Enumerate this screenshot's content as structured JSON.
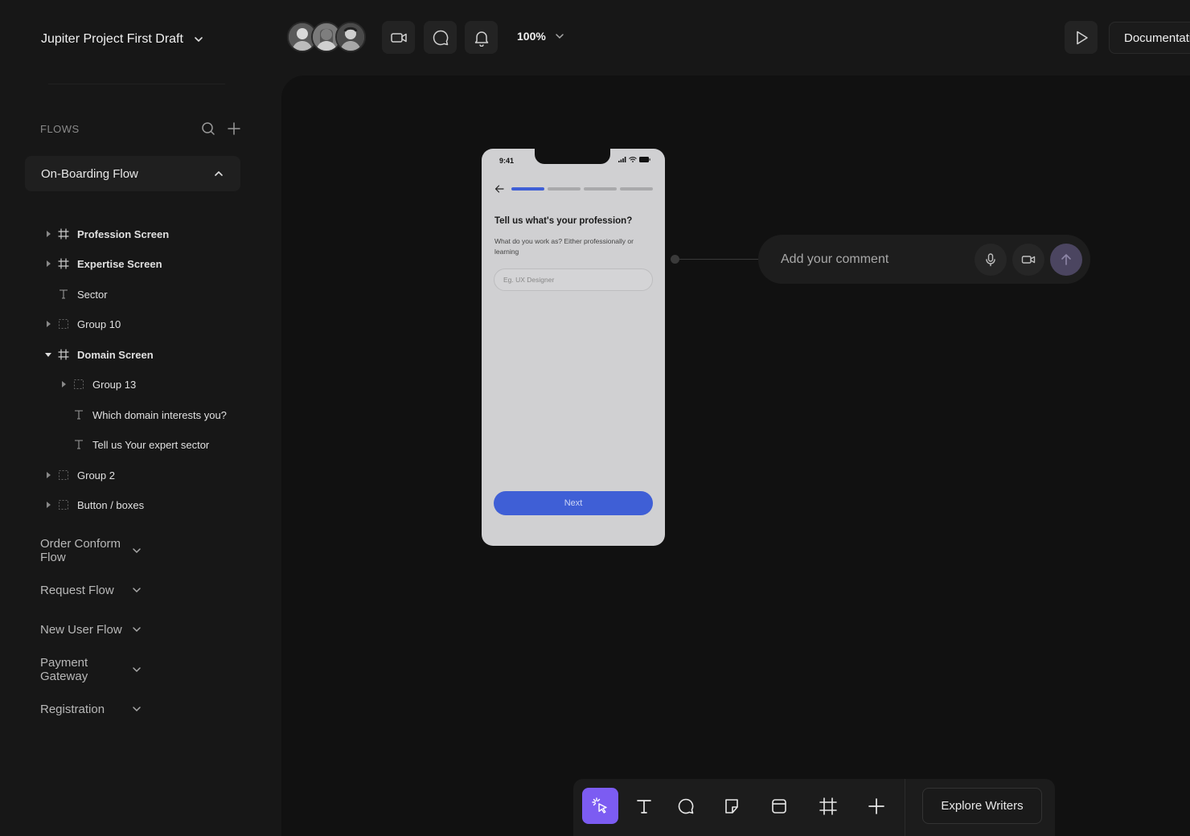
{
  "project": {
    "title": "Jupiter Project First Draft"
  },
  "sidebar": {
    "flows_label": "FLOWS",
    "active_flow": "On-Boarding Flow",
    "layers": [
      {
        "label": "Profession Screen",
        "type": "frame",
        "expandable": true,
        "expanded": false,
        "indent": 0,
        "bold": true
      },
      {
        "label": "Expertise Screen",
        "type": "frame",
        "expandable": true,
        "expanded": false,
        "indent": 0,
        "bold": true
      },
      {
        "label": "Sector",
        "type": "text",
        "expandable": false,
        "expanded": false,
        "indent": 0,
        "bold": false
      },
      {
        "label": "Group 10",
        "type": "group",
        "expandable": true,
        "expanded": false,
        "indent": 0,
        "bold": false
      },
      {
        "label": "Domain Screen",
        "type": "frame",
        "expandable": true,
        "expanded": true,
        "indent": 0,
        "bold": true
      },
      {
        "label": "Group 13",
        "type": "group",
        "expandable": true,
        "expanded": false,
        "indent": 1,
        "bold": false
      },
      {
        "label": "Which domain interests you?",
        "type": "text",
        "expandable": false,
        "expanded": false,
        "indent": 1,
        "bold": false
      },
      {
        "label": "Tell us Your expert sector",
        "type": "text",
        "expandable": false,
        "expanded": false,
        "indent": 1,
        "bold": false
      },
      {
        "label": "Group 2",
        "type": "group",
        "expandable": true,
        "expanded": false,
        "indent": 0,
        "bold": false
      },
      {
        "label": "Button / boxes",
        "type": "group",
        "expandable": true,
        "expanded": false,
        "indent": 0,
        "bold": false
      }
    ],
    "other_flows": [
      "Order Conform Flow",
      "Request Flow",
      "New User Flow",
      "Payment Gateway",
      "Registration"
    ]
  },
  "topbar": {
    "zoom": "100%",
    "documentation_label": "Documentation",
    "icons": [
      "video-icon",
      "comment-icon",
      "bell-icon",
      "play-icon"
    ]
  },
  "phone": {
    "time": "9:41",
    "progress_steps": 4,
    "progress_current": 1,
    "question": "Tell us what's your profession?",
    "subtitle": "What do you work as? Either professionally or learning",
    "input_placeholder": "Eg. UX Designer",
    "next_label": "Next"
  },
  "comment": {
    "placeholder": "Add your comment"
  },
  "toolbar": {
    "explore_label": "Explore Writers",
    "active_tool": "select"
  },
  "colors": {
    "accent": "#7c5cf2",
    "primary_blue": "#3f5fd6",
    "canvas": "#111111",
    "sidebar": "#171717"
  }
}
